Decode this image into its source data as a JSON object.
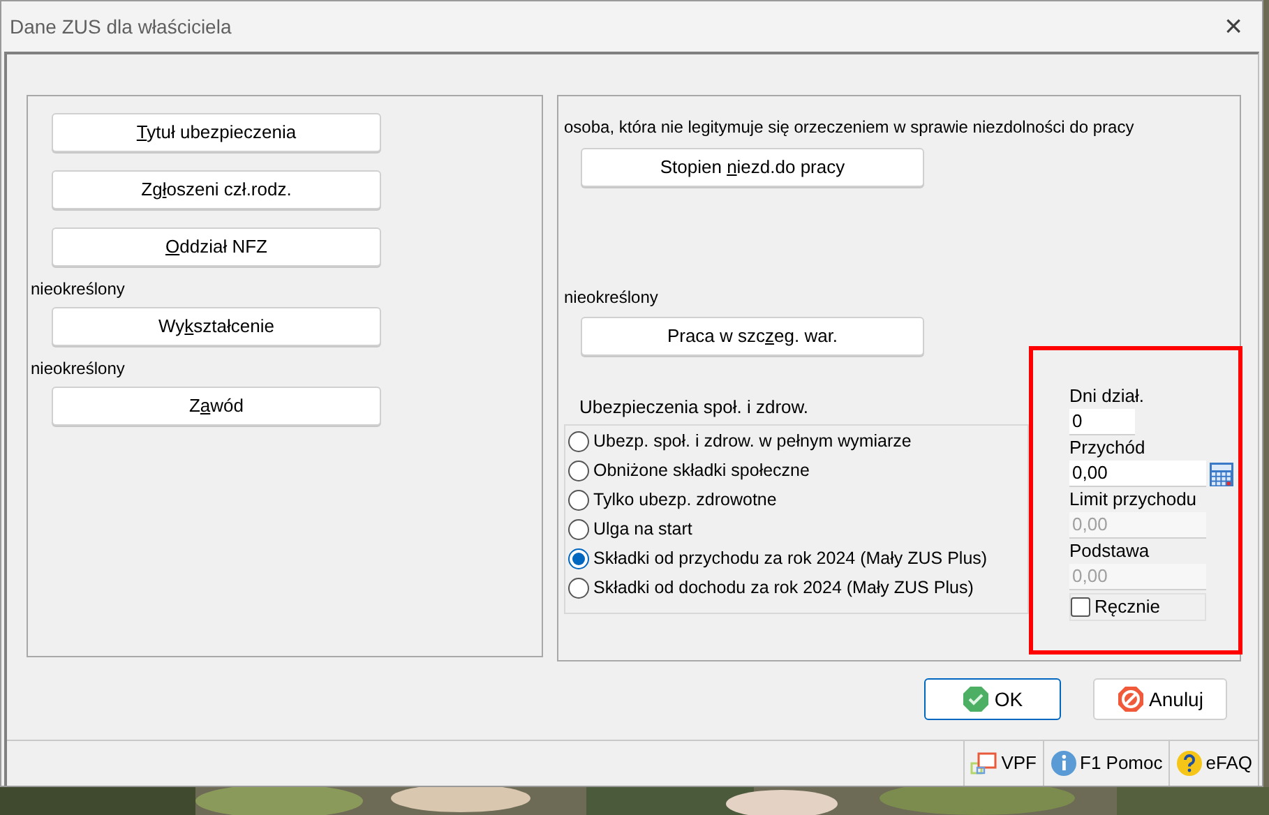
{
  "window": {
    "title": "Dane ZUS dla właściciela",
    "close": "×"
  },
  "left_panel": {
    "items": [
      {
        "kind": "button",
        "label": "Tytuł ubezpieczenia"
      },
      {
        "kind": "button",
        "label": "Zgłoszeni czł.rodz."
      },
      {
        "kind": "button",
        "label": "Oddział NFZ"
      },
      {
        "kind": "text",
        "label": "nieokreślony"
      },
      {
        "kind": "button",
        "label": "Wykształcenie"
      },
      {
        "kind": "text",
        "label": "nieokreślony"
      },
      {
        "kind": "button",
        "label": "Zawód"
      }
    ]
  },
  "right_panel": {
    "disability_status": "osoba, która nie legitymuje się orzeczeniem w sprawie niezdolności do pracy",
    "disability_button": {
      "label": "Stopien niezd.do pracy"
    },
    "conditions_status": "nieokreślony",
    "conditions_button": {
      "label": "Praca w szczeg. war."
    },
    "insurance": {
      "title": "Ubezpieczenia społ. i zdrow.",
      "options": [
        {
          "label": "Ubezp. społ. i zdrow. w pełnym wymiarze",
          "selected": false
        },
        {
          "label": "Obniżone składki społeczne",
          "selected": false
        },
        {
          "label": "Tylko ubezp. zdrowotne",
          "selected": false
        },
        {
          "label": "Ulga na start",
          "selected": false
        },
        {
          "label": "Składki od przychodu za rok 2024 (Mały ZUS Plus)",
          "selected": true
        },
        {
          "label": "Składki od dochodu za rok 2024 (Mały ZUS Plus)",
          "selected": false
        }
      ]
    },
    "income": {
      "highlighted": true,
      "fields": [
        {
          "label": "Dni dział.",
          "value": "0",
          "disabled": false,
          "kind": "short"
        },
        {
          "label": "Przychód",
          "value": "0,00",
          "disabled": false,
          "kind": "calculator"
        },
        {
          "label": "Limit przychodu",
          "value": "0,00",
          "disabled": true,
          "kind": "plain"
        },
        {
          "label": "Podstawa",
          "value": "0,00",
          "disabled": true,
          "kind": "plain"
        }
      ],
      "manual": {
        "label": "Ręcznie",
        "checked": false
      }
    }
  },
  "buttons": [
    {
      "kind": "ok",
      "label": "OK",
      "default": true
    },
    {
      "kind": "cancel",
      "label": "Anuluj",
      "default": false
    }
  ],
  "status_bar": [
    {
      "kind": "vpf",
      "label": "VPF"
    },
    {
      "kind": "help",
      "label": "F1 Pomoc"
    },
    {
      "kind": "faq",
      "label": "eFAQ"
    }
  ]
}
